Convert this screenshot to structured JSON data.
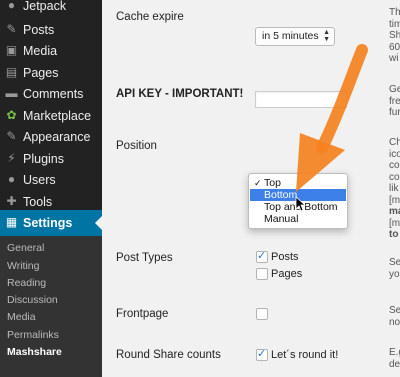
{
  "sidebar": {
    "items": [
      {
        "label": "Jetpack",
        "icon": "jetpack-icon",
        "glyph": "●"
      },
      {
        "label": "Posts",
        "icon": "pushpin-icon",
        "glyph": "✎"
      },
      {
        "label": "Media",
        "icon": "media-icon",
        "glyph": "▣"
      },
      {
        "label": "Pages",
        "icon": "pages-icon",
        "glyph": "▤"
      },
      {
        "label": "Comments",
        "icon": "comments-icon",
        "glyph": "▬"
      },
      {
        "label": "Marketplace",
        "icon": "marketplace-icon",
        "glyph": "✿"
      },
      {
        "label": "Appearance",
        "icon": "appearance-icon",
        "glyph": "✎"
      },
      {
        "label": "Plugins",
        "icon": "plugins-icon",
        "glyph": "⚡"
      },
      {
        "label": "Users",
        "icon": "users-icon",
        "glyph": "●"
      },
      {
        "label": "Tools",
        "icon": "tools-icon",
        "glyph": "✚"
      },
      {
        "label": "Settings",
        "icon": "settings-icon",
        "glyph": "▦"
      }
    ],
    "submenu": [
      "General",
      "Writing",
      "Reading",
      "Discussion",
      "Media",
      "Permalinks",
      "Mashshare"
    ]
  },
  "settings": {
    "cache_expire": {
      "label": "Cache expire",
      "value": "in 5 minutes"
    },
    "api_key": {
      "label": "API KEY - IMPORTANT!",
      "value": ""
    },
    "position": {
      "label": "Position",
      "options": [
        "Top",
        "Bottom",
        "Top and Bottom",
        "Manual"
      ],
      "checked": "Top",
      "highlighted": "Bottom"
    },
    "post_types": {
      "label": "Post Types",
      "options": [
        {
          "label": "Posts",
          "checked": true
        },
        {
          "label": "Pages",
          "checked": false
        }
      ]
    },
    "frontpage": {
      "label": "Frontpage",
      "checked": false
    },
    "round_share_counts": {
      "label": "Round Share counts",
      "option_label": "Let´s round it!",
      "checked": true
    }
  },
  "descriptions": {
    "cache": [
      "Th",
      "tim",
      "Sh",
      "60",
      "wi"
    ],
    "api": [
      "Ge",
      "fre",
      "fur"
    ],
    "position": [
      "Ch",
      "ico",
      "co",
      "co",
      "lik",
      "[m",
      "ma",
      "[m",
      "to"
    ],
    "post_types": [
      "Se",
      "yo"
    ],
    "frontpage": [
      "Se",
      "no"
    ],
    "round": [
      "E.g",
      "de"
    ]
  },
  "colors": {
    "sidebar_bg": "#222222",
    "submenu_bg": "#333333",
    "active_bg": "#0074a2",
    "content_bg": "#f1f1f1",
    "highlight": "#3d80e9",
    "annotation_arrow": "#f58220"
  }
}
